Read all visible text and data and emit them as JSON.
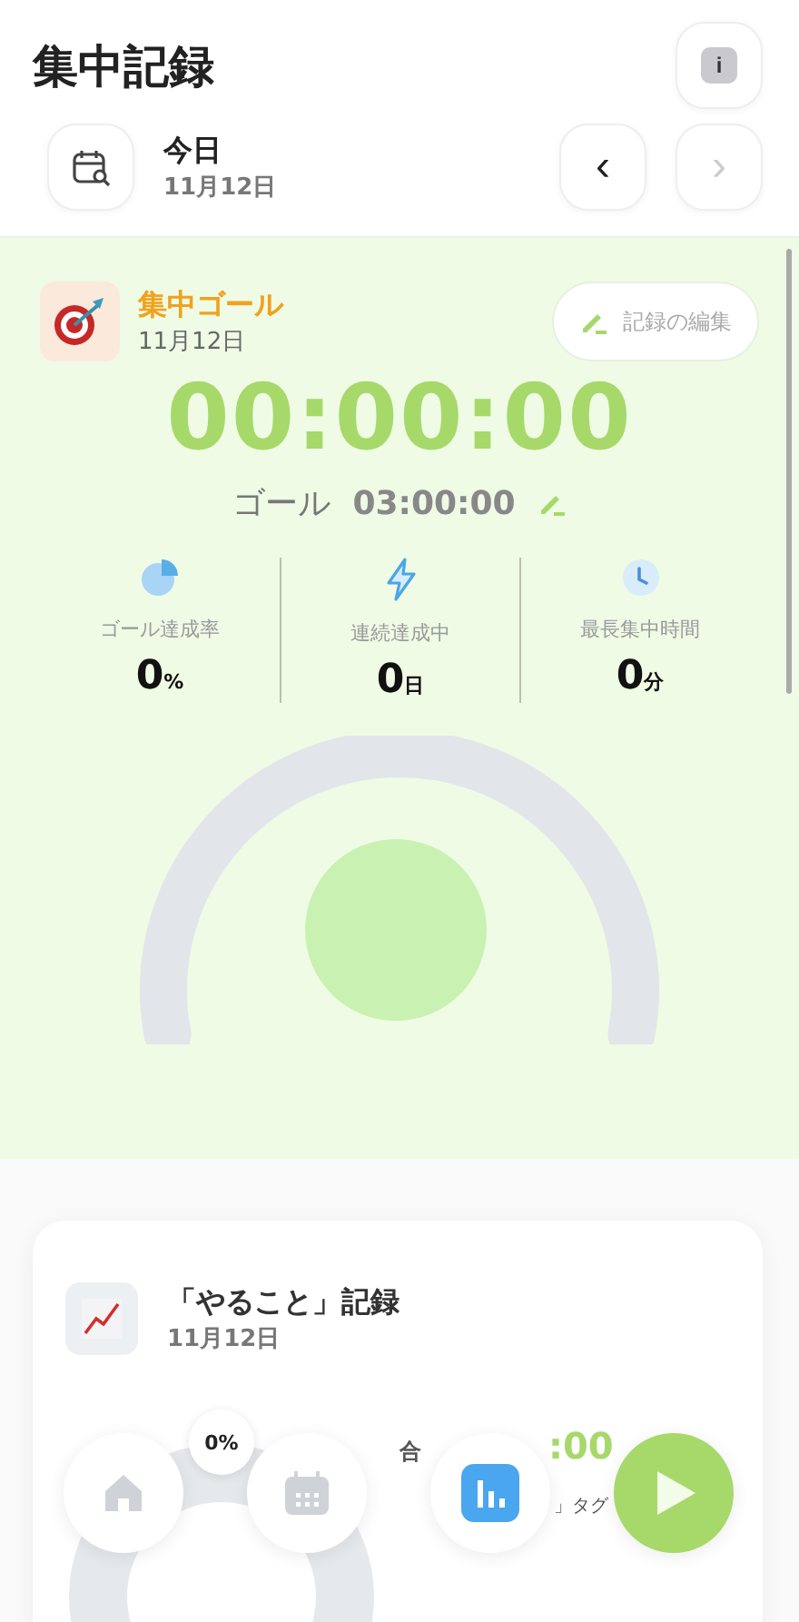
{
  "header": {
    "title": "集中記録",
    "info_label": "i"
  },
  "date_bar": {
    "label": "今日",
    "date": "11月12日",
    "prev": {
      "label": "‹",
      "disabled": false
    },
    "next": {
      "label": "›",
      "disabled": true
    }
  },
  "goal_panel": {
    "title": "集中ゴール",
    "date": "11月12日",
    "edit_button": "記録の編集",
    "timer": "00:00:00",
    "goal_label": "ゴール",
    "goal_time": "03:00:00",
    "stats": [
      {
        "kind": "pie",
        "label": "ゴール達成率",
        "value": "0",
        "unit": "%"
      },
      {
        "kind": "bolt",
        "label": "連続達成中",
        "value": "0",
        "unit": "日"
      },
      {
        "kind": "clock",
        "label": "最長集中時間",
        "value": "0",
        "unit": "分"
      }
    ],
    "has_gauge": true
  },
  "todo_card": {
    "title": "「やること」記録",
    "date": "11月12日",
    "percent": "0%",
    "total_fragment": "合",
    "time_fragment": ":00",
    "tag_fragment": "」タグ"
  },
  "nav": [
    {
      "kind": "home",
      "selected": false
    },
    {
      "kind": "calendar",
      "selected": false
    },
    {
      "kind": "stats",
      "selected": true
    },
    {
      "kind": "play",
      "selected": false
    }
  ]
}
